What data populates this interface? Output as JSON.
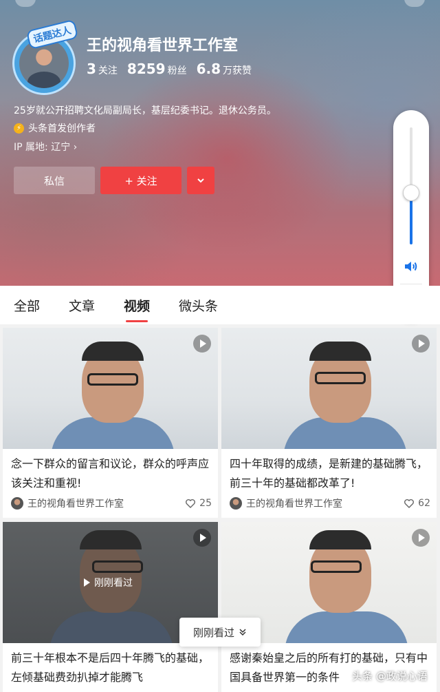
{
  "profile": {
    "badge": "话题达人",
    "name": "王的视角看世界工作室",
    "stats": [
      {
        "value": "3",
        "label": "关注"
      },
      {
        "value": "8259",
        "label": "粉丝"
      },
      {
        "value": "6.8",
        "label": "万获赞"
      }
    ],
    "bio": "25岁就公开招聘文化局副局长，基层纪委书记。退休公务员。",
    "creator_icon": "lightning-icon",
    "creator_label": "头条首发创作者",
    "ip_label": "IP 属地: 辽宁 ›",
    "buttons": {
      "message": "私信",
      "follow": "+ 关注",
      "more": "chevron-down-icon"
    }
  },
  "volume": {
    "level": 0.44,
    "speaker_icon": "speaker-icon",
    "settings_icon": "gear-icon",
    "accent": "#1a73e8"
  },
  "tabs": [
    {
      "label": "全部",
      "active": false
    },
    {
      "label": "文章",
      "active": false
    },
    {
      "label": "视频",
      "active": true
    },
    {
      "label": "微头条",
      "active": false
    }
  ],
  "accent": "#f04142",
  "videos": [
    {
      "title": "念一下群众的留言和议论，群众的呼声应该关注和重视!",
      "author": "王的视角看世界工作室",
      "likes": "25"
    },
    {
      "title": "四十年取得的成绩，是新建的基础腾飞，前三十年的基础都改革了!",
      "author": "王的视角看世界工作室",
      "likes": "62"
    },
    {
      "title": "前三十年根本不是后四十年腾飞的基础，左倾基础费劲扒掉才能腾飞",
      "watched_label": "刚刚看过"
    },
    {
      "title": "感谢秦始皇之后的所有打的基础，只有中国具备世界第一的条件"
    }
  ],
  "floating": {
    "watched_pill": "刚刚看过",
    "watermark": "头条 @政说心语"
  }
}
